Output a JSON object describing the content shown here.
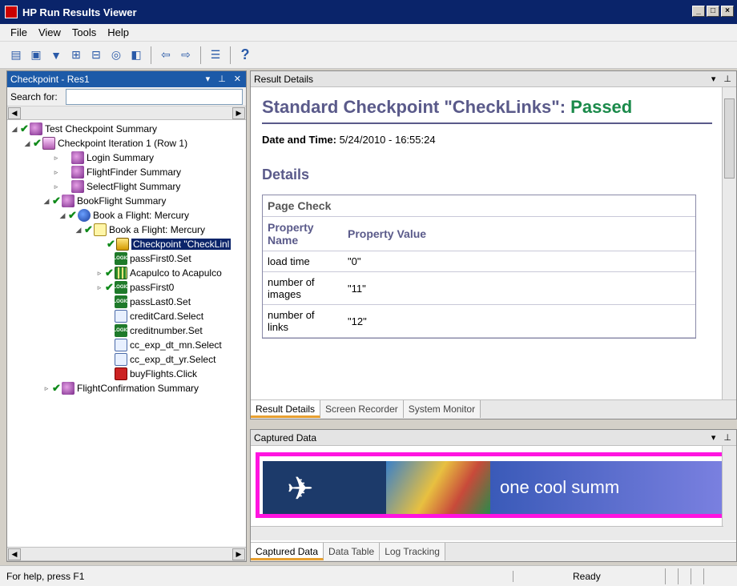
{
  "window": {
    "title": "HP Run Results Viewer"
  },
  "menu": [
    "File",
    "View",
    "Tools",
    "Help"
  ],
  "left_panel": {
    "title": "Checkpoint - Res1",
    "search_label": "Search for:",
    "search_value": ""
  },
  "tree": [
    {
      "label": "Test Checkpoint Summary",
      "icon": "summary-icon"
    },
    {
      "label": "Checkpoint Iteration 1 (Row 1)",
      "icon": "iteration-icon"
    },
    {
      "label": "Login Summary",
      "icon": "summary-icon"
    },
    {
      "label": "FlightFinder Summary",
      "icon": "summary-icon"
    },
    {
      "label": "SelectFlight Summary",
      "icon": "summary-icon"
    },
    {
      "label": "BookFlight Summary",
      "icon": "summary-icon"
    },
    {
      "label": "Book a Flight: Mercury",
      "icon": "action-icon"
    },
    {
      "label": "Book a Flight: Mercury",
      "icon": "page-icon"
    },
    {
      "label": "Checkpoint \"CheckLinl",
      "icon": "checkpoint-icon"
    },
    {
      "label": "passFirst0.Set",
      "icon": "logic-icon"
    },
    {
      "label": "Acapulco to Acapulco",
      "icon": "table-icon"
    },
    {
      "label": "passFirst0",
      "icon": "logic-icon"
    },
    {
      "label": "passLast0.Set",
      "icon": "logic-icon"
    },
    {
      "label": "creditCard.Select",
      "icon": "list-icon"
    },
    {
      "label": "creditnumber.Set",
      "icon": "logic-icon"
    },
    {
      "label": "cc_exp_dt_mn.Select",
      "icon": "list-icon"
    },
    {
      "label": "cc_exp_dt_yr.Select",
      "icon": "list-icon"
    },
    {
      "label": "buyFlights.Click",
      "icon": "button-icon"
    },
    {
      "label": "FlightConfirmation Summary",
      "icon": "summary-icon"
    }
  ],
  "result_details": {
    "panel_title": "Result Details",
    "heading": "Standard Checkpoint \"CheckLinks\":",
    "status": "Passed",
    "date_label": "Date and Time:",
    "date_value": "5/24/2010 - 16:55:24",
    "details_heading": "Details",
    "page_check": "Page Check",
    "col_name": "Property Name",
    "col_value": "Property Value",
    "rows": [
      {
        "name": "load time",
        "value": "\"0\""
      },
      {
        "name": "number of images",
        "value": "\"11\""
      },
      {
        "name": "number of links",
        "value": "\"12\""
      }
    ],
    "tabs": [
      "Result Details",
      "Screen Recorder",
      "System Monitor"
    ]
  },
  "captured_data": {
    "panel_title": "Captured Data",
    "banner_text": "one cool summ",
    "tabs": [
      "Captured Data",
      "Data Table",
      "Log Tracking"
    ]
  },
  "status": {
    "help": "For help, press F1",
    "state": "Ready"
  },
  "colors": {
    "accent": "#1c5aa8",
    "passed": "#1a8a4a",
    "highlight": "#ff14e0"
  }
}
